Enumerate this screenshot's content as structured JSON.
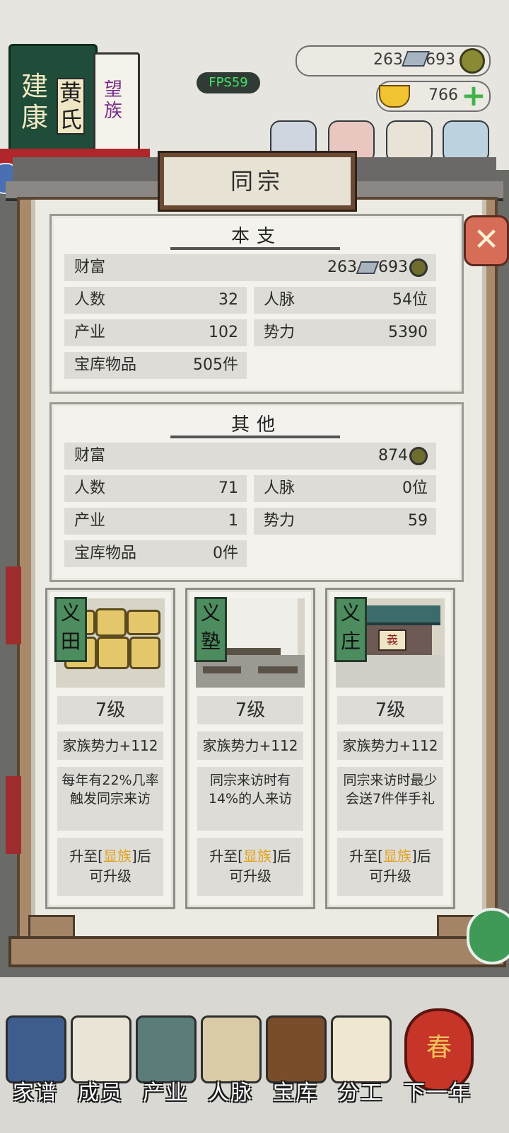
{
  "header": {
    "family_book": {
      "city": "建康",
      "surname": "黄氏",
      "rank_book": "望族"
    },
    "fps": "FPS59",
    "resources": {
      "silver": "263",
      "coins": "693",
      "gold": "766"
    }
  },
  "dialog": {
    "title": "同宗",
    "sections": [
      {
        "heading": "本支",
        "wealth_label": "财富",
        "wealth_silver": "263",
        "wealth_coins": "693",
        "stats": [
          {
            "label": "人数",
            "value": "32"
          },
          {
            "label": "人脉",
            "value": "54位"
          },
          {
            "label": "产业",
            "value": "102"
          },
          {
            "label": "势力",
            "value": "5390"
          },
          {
            "label": "宝库物品",
            "value": "505件"
          }
        ]
      },
      {
        "heading": "其他",
        "wealth_label": "财富",
        "wealth_coins": "874",
        "stats": [
          {
            "label": "人数",
            "value": "71"
          },
          {
            "label": "人脉",
            "value": "0位"
          },
          {
            "label": "产业",
            "value": "1"
          },
          {
            "label": "势力",
            "value": "59"
          },
          {
            "label": "宝库物品",
            "value": "0件"
          }
        ]
      }
    ],
    "cards": [
      {
        "tag_line1": "义",
        "tag_line2": "田",
        "level": "7级",
        "bonus": "家族势力+112",
        "desc": "每年有22%几率触发同宗来访",
        "req_prefix": "升至[",
        "req_highlight": "显族",
        "req_suffix": "]后",
        "req_line2": "可升级"
      },
      {
        "tag_line1": "义",
        "tag_line2": "塾",
        "level": "7级",
        "bonus": "家族势力+112",
        "desc": "同宗来访时有14%的人来访",
        "req_prefix": "升至[",
        "req_highlight": "显族",
        "req_suffix": "]后",
        "req_line2": "可升级"
      },
      {
        "tag_line1": "义",
        "tag_line2": "庄",
        "level": "7级",
        "bonus": "家族势力+112",
        "desc": "同宗来访时最少会送7件伴手礼",
        "req_prefix": "升至[",
        "req_highlight": "显族",
        "req_suffix": "]后",
        "req_line2": "可升级"
      }
    ]
  },
  "bottom_nav": [
    {
      "label": "家谱"
    },
    {
      "label": "成员"
    },
    {
      "label": "产业"
    },
    {
      "label": "人脉"
    },
    {
      "label": "宝库"
    },
    {
      "label": "分工"
    },
    {
      "label": "下一年"
    }
  ],
  "lantern_char": "春",
  "colors": {
    "highlight": "#e2a21b",
    "fps_text": "#47e26a",
    "tag_green": "#4c8c5e",
    "close_red": "#d86d57"
  }
}
